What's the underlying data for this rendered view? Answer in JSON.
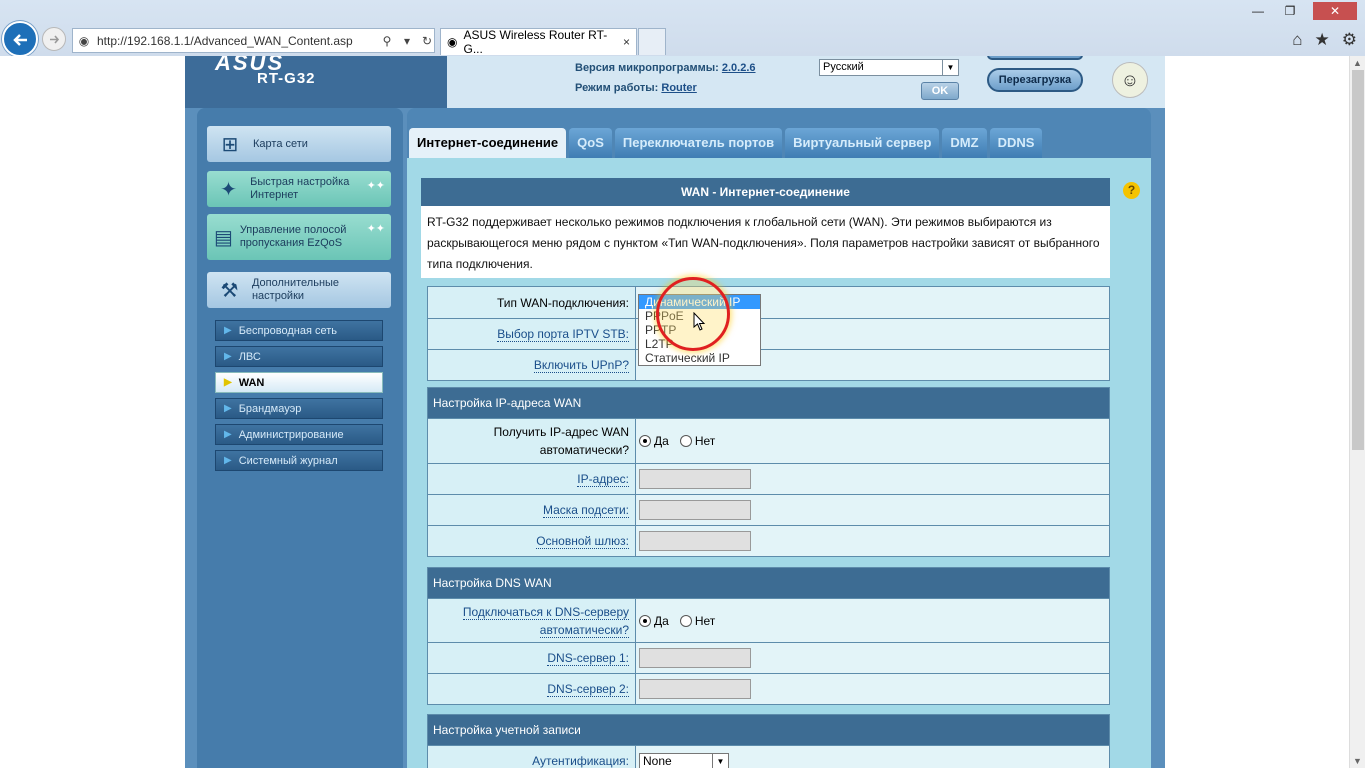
{
  "browser": {
    "url": "http://192.168.1.1/Advanced_WAN_Content.asp",
    "tab_title": "ASUS Wireless Router RT-G...",
    "tab_close": "×"
  },
  "router": {
    "logo": "ASUS",
    "model": "RT-G32",
    "firmware_label": "Версия микропрограммы:",
    "firmware_value": "2.0.2.6",
    "mode_label": "Режим работы:",
    "mode_value": "Router",
    "language": "Русский",
    "ok_button": "OK",
    "reboot_button": "Перезагрузка"
  },
  "sidebar": {
    "big_items": [
      {
        "label": "Карта сети"
      },
      {
        "label": "Быстрая настройка Интернет"
      },
      {
        "label": "Управление полосой пропускания EzQoS"
      },
      {
        "label": "Дополнительные настройки"
      }
    ],
    "sub_items": [
      {
        "label": "Беспроводная сеть"
      },
      {
        "label": "ЛВС"
      },
      {
        "label": "WAN"
      },
      {
        "label": "Брандмауэр"
      },
      {
        "label": "Администрирование"
      },
      {
        "label": "Системный журнал"
      }
    ]
  },
  "tabs": [
    {
      "label": "Интернет-соединение"
    },
    {
      "label": "QoS"
    },
    {
      "label": "Переключатель портов"
    },
    {
      "label": "Виртуальный сервер"
    },
    {
      "label": "DMZ"
    },
    {
      "label": "DDNS"
    }
  ],
  "main": {
    "title": "WAN - Интернет-соединение",
    "help": "?",
    "description": "RT-G32 поддерживает несколько режимов подключения к глобальной сети (WAN). Эти режимов выбираются из раскрывающегося меню рядом с пунктом «Тип WAN-подключения». Поля параметров настройки зависят от выбранного типа подключения.",
    "wan_type_label": "Тип WAN-подключения:",
    "iptv_label": "Выбор порта IPTV STB:",
    "upnp_label": "Включить UPnP?",
    "wan_options": [
      "Динамический IP",
      "PPPoE",
      "PPTP",
      "L2TP",
      "Статический IP"
    ],
    "ip_section": {
      "header": "Настройка IP-адреса WAN",
      "auto_label": "Получить IP-адрес WAN автоматически?",
      "yes": "Да",
      "no": "Нет",
      "ip_label": "IP-адрес:",
      "mask_label": "Маска подсети:",
      "gateway_label": "Основной шлюз:"
    },
    "dns_section": {
      "header": "Настройка DNS WAN",
      "auto_label": "Подключаться к DNS-серверу автоматически?",
      "yes": "Да",
      "no": "Нет",
      "dns1_label": "DNS-сервер 1:",
      "dns2_label": "DNS-сервер 2:"
    },
    "account_section": {
      "header": "Настройка учетной записи",
      "auth_label": "Аутентификация:",
      "auth_value": "None"
    }
  }
}
